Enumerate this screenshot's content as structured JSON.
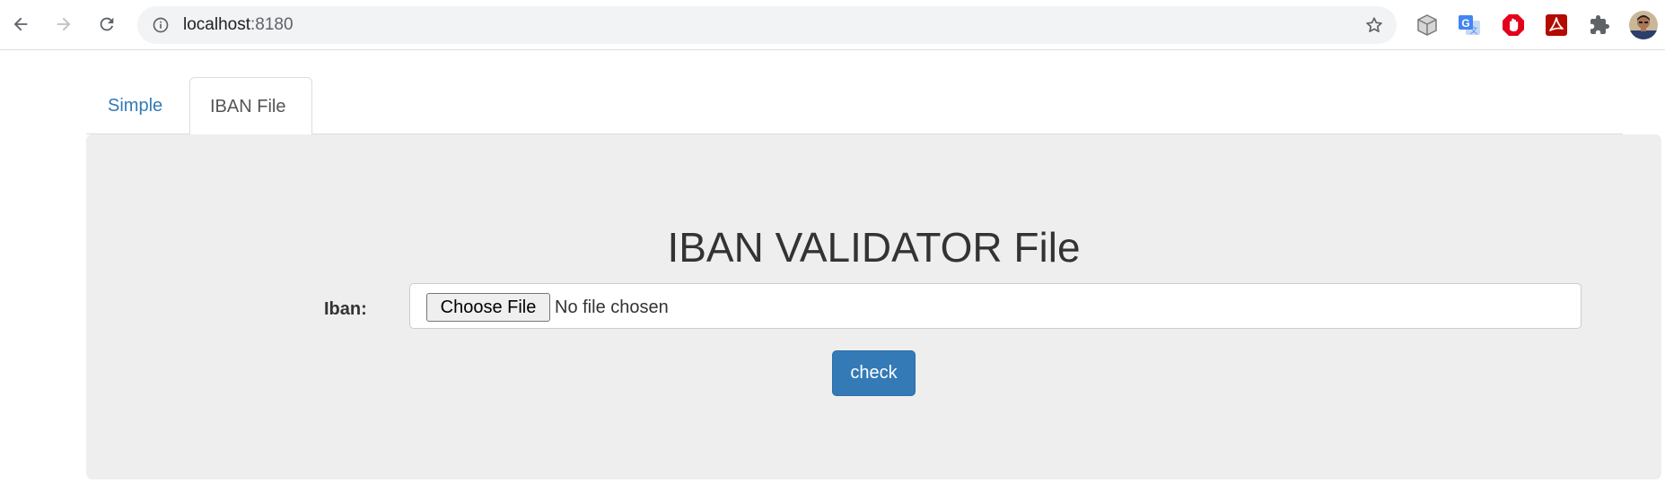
{
  "browser": {
    "url_host": "localhost",
    "url_port": ":8180",
    "icons": {
      "back": "arrow-left-icon",
      "forward": "arrow-right-icon",
      "reload": "reload-icon",
      "info": "info-icon",
      "bookmark": "star-icon"
    },
    "extensions": [
      "cube-extension-icon",
      "google-translate-icon",
      "adblock-icon",
      "adobe-acrobat-icon",
      "puzzle-extensions-icon",
      "profile-avatar"
    ]
  },
  "tabs": [
    {
      "label": "Simple",
      "active": false
    },
    {
      "label": "IBAN File",
      "active": true
    }
  ],
  "panel": {
    "title": "IBAN VALIDATOR File",
    "iban_label": "Iban:",
    "choose_file_label": "Choose File",
    "file_status": "No file chosen",
    "check_label": "check"
  },
  "colors": {
    "link": "#337ab7",
    "primary_button": "#337ab7",
    "panel_bg": "#eeeeee"
  }
}
